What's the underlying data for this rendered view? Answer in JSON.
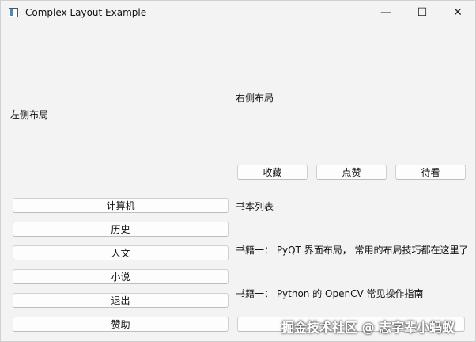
{
  "window": {
    "title": "Complex Layout Example",
    "controls": {
      "minimize": "—",
      "maximize": "☐",
      "close": "✕"
    }
  },
  "left_panel": {
    "label": "左侧布局",
    "buttons": [
      "计算机",
      "历史",
      "人文",
      "小说",
      "退出",
      "赞助"
    ]
  },
  "right_panel": {
    "label": "右侧布局",
    "action_buttons": [
      "收藏",
      "点赞",
      "待看"
    ],
    "list_title": "书本列表",
    "books": [
      "书籍一： PyQT 界面布局， 常用的布局技巧都在这里了",
      "书籍一： Python 的 OpenCV 常见操作指南"
    ]
  },
  "watermark": "掘金技术社区 @ 志字辈小蚂蚁"
}
